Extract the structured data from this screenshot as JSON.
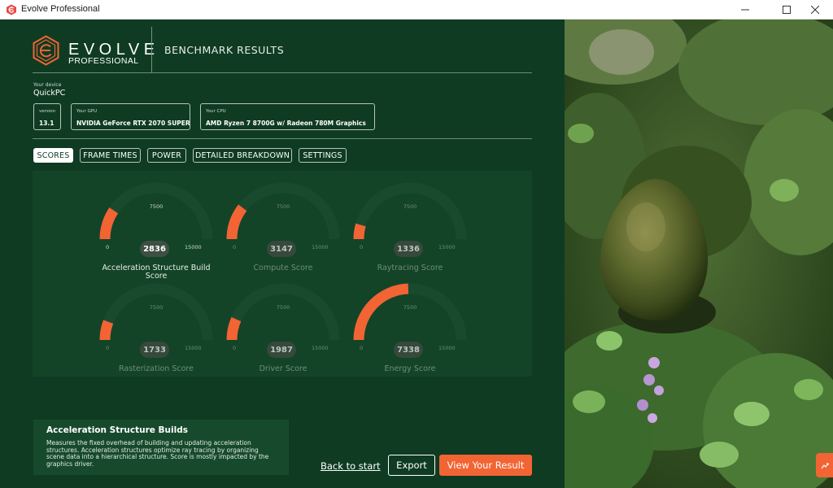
{
  "window": {
    "title": "Evolve Professional"
  },
  "brand": {
    "name": "EVOLVE",
    "edition": "PROFESSIONAL"
  },
  "header": {
    "title": "BENCHMARK RESULTS"
  },
  "device": {
    "label": "Your device",
    "name": "QuickPC",
    "version_label": "version",
    "version": "13.1",
    "gpu_label": "Your GPU",
    "gpu": "NVIDIA GeForce RTX 2070 SUPER",
    "cpu_label": "Your CPU",
    "cpu": "AMD Ryzen 7 8700G w/ Radeon 780M Graphics"
  },
  "tabs": [
    {
      "label": "SCORES",
      "active": true
    },
    {
      "label": "FRAME TIMES",
      "active": false
    },
    {
      "label": "POWER",
      "active": false
    },
    {
      "label": "DETAILED BREAKDOWN",
      "active": false
    },
    {
      "label": "SETTINGS",
      "active": false
    }
  ],
  "gauges": [
    {
      "label": "Acceleration Structure Build Score",
      "value": "2836",
      "score": 2836,
      "min": "0",
      "mid": "7500",
      "max": "15000",
      "selected": true
    },
    {
      "label": "Compute Score",
      "value": "3147",
      "score": 3147,
      "min": "0",
      "mid": "7500",
      "max": "15000",
      "selected": false
    },
    {
      "label": "Raytracing Score",
      "value": "1336",
      "score": 1336,
      "min": "0",
      "mid": "7500",
      "max": "15000",
      "selected": false
    },
    {
      "label": "Rasterization Score",
      "value": "1733",
      "score": 1733,
      "min": "0",
      "mid": "7500",
      "max": "15000",
      "selected": false
    },
    {
      "label": "Driver Score",
      "value": "1987",
      "score": 1987,
      "min": "0",
      "mid": "7500",
      "max": "15000",
      "selected": false
    },
    {
      "label": "Energy Score",
      "value": "7338",
      "score": 7338,
      "min": "0",
      "mid": "7500",
      "max": "15000",
      "selected": false
    }
  ],
  "gauge_scale_max": 15000,
  "description": {
    "title": "Acceleration Structure Builds",
    "body": "Measures the fixed overhead of building and updating acceleration structures. Acceleration structures optimize ray tracing by organizing scene data into a hierarchical structure. Score is mostly impacted by the graphics driver."
  },
  "actions": {
    "back": "Back to start",
    "export": "Export",
    "view": "View Your Result"
  },
  "colors": {
    "panel": "#0f3b22",
    "accent": "#f26434",
    "track": "#1a4a2e"
  },
  "icons": {
    "app": "evolve-logo-icon",
    "minimize": "minimize-icon",
    "maximize": "maximize-icon",
    "close": "close-icon",
    "share": "share-icon"
  }
}
